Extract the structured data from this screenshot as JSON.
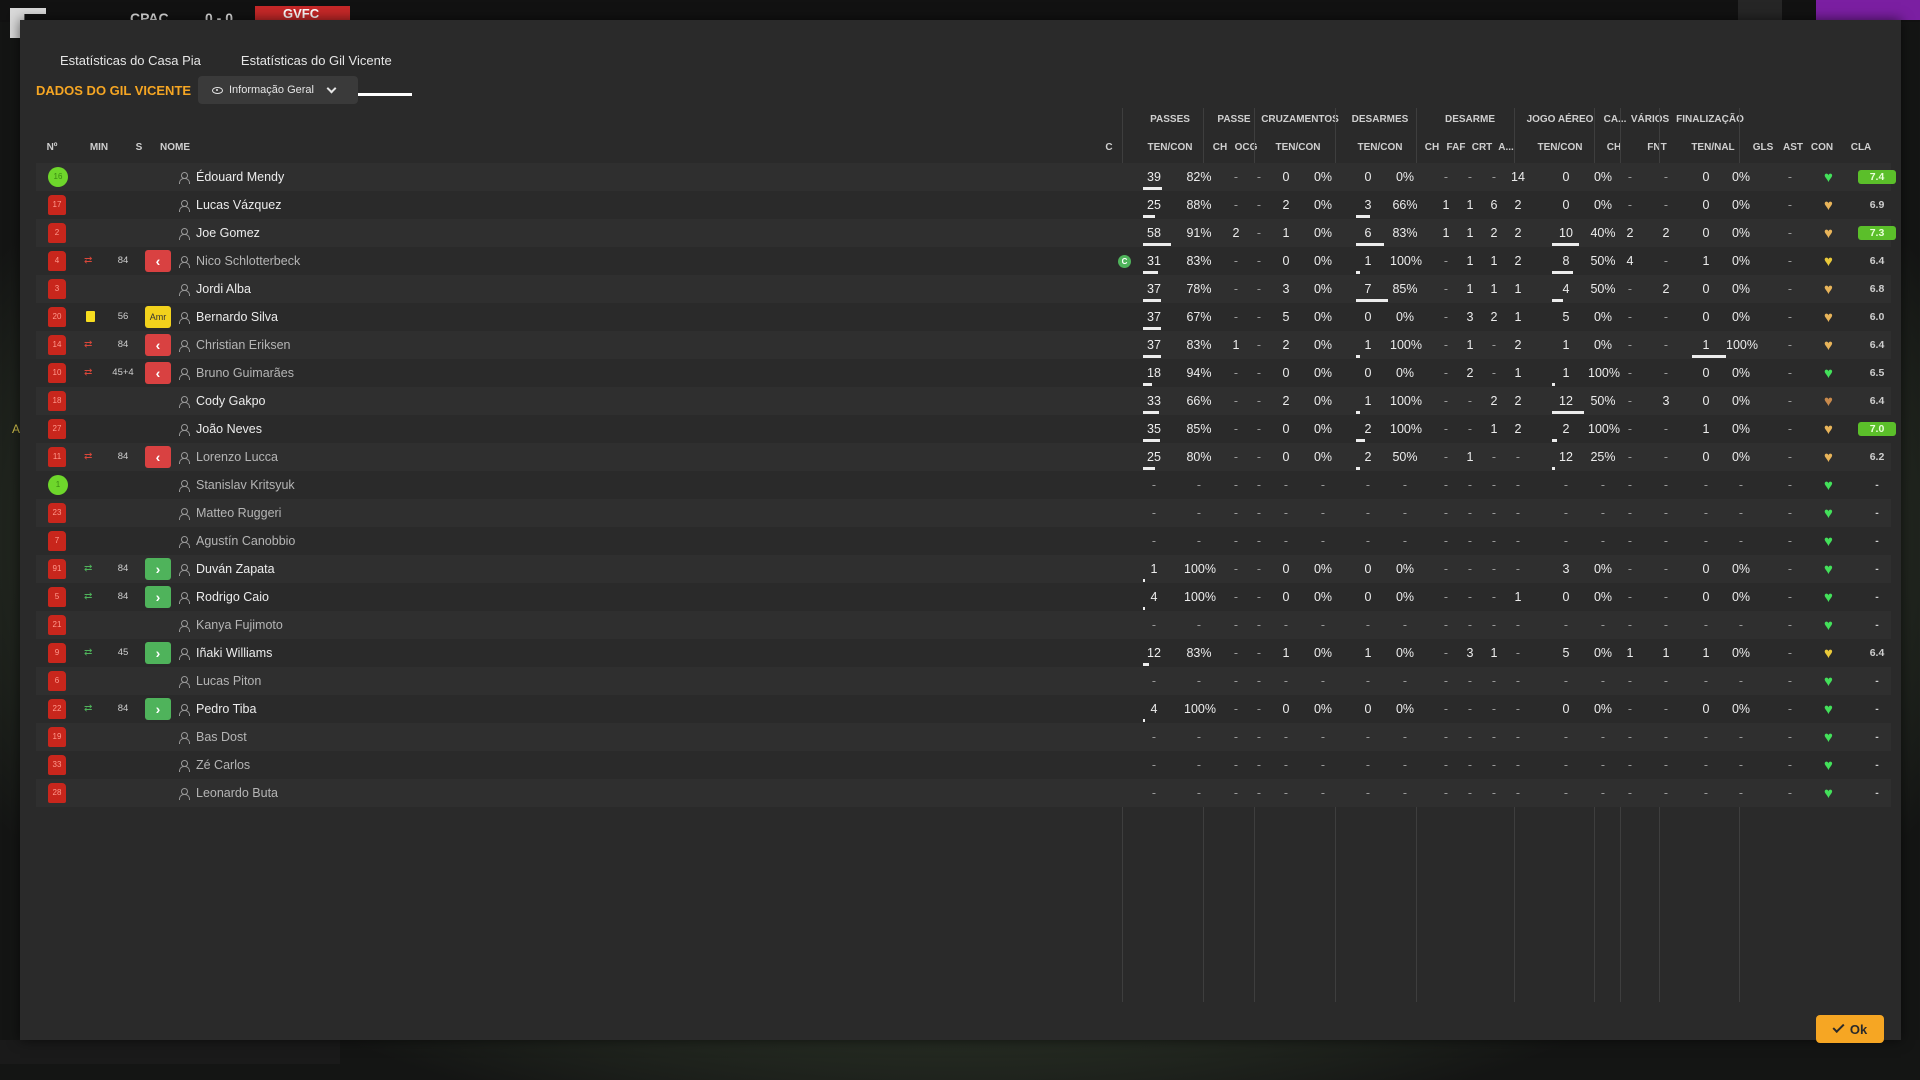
{
  "background": {
    "home_abbr": "CPAC",
    "score": "0 - 0",
    "away_abbr": "GVFC",
    "side_letter": "A"
  },
  "tabs": [
    {
      "label": "Estatísticas do Casa Pia",
      "active": false
    },
    {
      "label": "Estatísticas do Gil Vicente",
      "active": true
    }
  ],
  "section_title": "DADOS DO GIL VICENTE",
  "view_select": {
    "selected": "Informação Geral"
  },
  "group_headers": {
    "passes": "PASSES",
    "passe": "PASSE",
    "cruzamentos": "CRUZAMENTOS",
    "desarmes": "DESARMES",
    "desarme": "DESARME",
    "jogo_aereo": "JOGO AÉREO",
    "ca": "CA...",
    "varios": "VÁRIOS",
    "finalizacao": "FINALIZAÇÃO"
  },
  "col_headers": {
    "n": "Nº",
    "min": "MIN",
    "s": "S",
    "nome": "NOME",
    "c": "C",
    "passes_tc": "TEN/CON",
    "passe_ch": "CH",
    "passe_ocg": "OCG",
    "cruz_tc": "TEN/CON",
    "des_tc": "TEN/CON",
    "desarme_ch": "CH",
    "desarme_faf": "FAF",
    "desarme_crt": "CRT",
    "desarme_a": "A...",
    "aereo_tc": "TEN/CON",
    "ca_ch": "CH",
    "varios_fnt": "FNT",
    "fin_tn": "TEN/NAL",
    "gls": "GLS",
    "ast": "AST",
    "con": "CON",
    "cla": "CLA"
  },
  "players": [
    {
      "no": "16",
      "gk": true,
      "event": "",
      "min": "",
      "s": "",
      "name": "Édouard Mendy",
      "dim": false,
      "captain": false,
      "p_t": "39",
      "p_pct": "82%",
      "p_bar": 0.67,
      "ch": "-",
      "ocg": "-",
      "cr_t": "0",
      "cr_pct": "0%",
      "d_t": "0",
      "d_pct": "0%",
      "d_bar": 0,
      "dch": "-",
      "faf": "-",
      "crt": "-",
      "da": "14",
      "a_t": "0",
      "a_pct": "0%",
      "a_bar": 0,
      "cach": "-",
      "fnt": "-",
      "f_t": "0",
      "f_pct": "0%",
      "f_bar": 0,
      "gls": "",
      "ast": "-",
      "con": "g",
      "cla": "7.4",
      "cla_hl": true
    },
    {
      "no": "17",
      "gk": false,
      "event": "",
      "min": "",
      "s": "",
      "name": "Lucas Vázquez",
      "dim": false,
      "captain": false,
      "p_t": "25",
      "p_pct": "88%",
      "p_bar": 0.43,
      "ch": "-",
      "ocg": "-",
      "cr_t": "2",
      "cr_pct": "0%",
      "d_t": "3",
      "d_pct": "66%",
      "d_bar": 0.43,
      "dch": "1",
      "faf": "1",
      "crt": "6",
      "da": "2",
      "a_t": "0",
      "a_pct": "0%",
      "a_bar": 0,
      "cach": "-",
      "fnt": "-",
      "f_t": "0",
      "f_pct": "0%",
      "f_bar": 0,
      "gls": "",
      "ast": "-",
      "con": "o",
      "cla": "6.9",
      "cla_hl": false
    },
    {
      "no": "2",
      "gk": false,
      "event": "",
      "min": "",
      "s": "",
      "name": "Joe Gomez",
      "dim": false,
      "captain": false,
      "p_t": "58",
      "p_pct": "91%",
      "p_bar": 1.0,
      "ch": "2",
      "ocg": "-",
      "cr_t": "1",
      "cr_pct": "0%",
      "d_t": "6",
      "d_pct": "83%",
      "d_bar": 0.86,
      "dch": "1",
      "faf": "1",
      "crt": "2",
      "da": "2",
      "a_t": "10",
      "a_pct": "40%",
      "a_bar": 0.83,
      "cach": "2",
      "fnt": "2",
      "f_t": "0",
      "f_pct": "0%",
      "f_bar": 0,
      "gls": "",
      "ast": "-",
      "con": "o",
      "cla": "7.3",
      "cla_hl": true
    },
    {
      "no": "4",
      "gk": false,
      "event": "out",
      "min": "84",
      "s": "out",
      "name": "Nico Schlotterbeck",
      "dim": true,
      "captain": true,
      "p_t": "31",
      "p_pct": "83%",
      "p_bar": 0.53,
      "ch": "-",
      "ocg": "-",
      "cr_t": "0",
      "cr_pct": "0%",
      "d_t": "1",
      "d_pct": "100%",
      "d_bar": 0.14,
      "dch": "-",
      "faf": "1",
      "crt": "1",
      "da": "2",
      "a_t": "8",
      "a_pct": "50%",
      "a_bar": 0.67,
      "cach": "4",
      "fnt": "-",
      "f_t": "1",
      "f_pct": "0%",
      "f_bar": 0,
      "gls": "",
      "ast": "-",
      "con": "y",
      "cla": "6.4",
      "cla_hl": false
    },
    {
      "no": "3",
      "gk": false,
      "event": "",
      "min": "",
      "s": "",
      "name": "Jordi Alba",
      "dim": false,
      "captain": false,
      "p_t": "37",
      "p_pct": "78%",
      "p_bar": 0.64,
      "ch": "-",
      "ocg": "-",
      "cr_t": "3",
      "cr_pct": "0%",
      "d_t": "7",
      "d_pct": "85%",
      "d_bar": 1.0,
      "dch": "-",
      "faf": "1",
      "crt": "1",
      "da": "1",
      "a_t": "4",
      "a_pct": "50%",
      "a_bar": 0.33,
      "cach": "-",
      "fnt": "2",
      "f_t": "0",
      "f_pct": "0%",
      "f_bar": 0,
      "gls": "",
      "ast": "-",
      "con": "o",
      "cla": "6.8",
      "cla_hl": false
    },
    {
      "no": "20",
      "gk": false,
      "event": "yellow",
      "min": "56",
      "s": "amr",
      "name": "Bernardo Silva",
      "dim": false,
      "captain": false,
      "p_t": "37",
      "p_pct": "67%",
      "p_bar": 0.64,
      "ch": "-",
      "ocg": "-",
      "cr_t": "5",
      "cr_pct": "0%",
      "d_t": "0",
      "d_pct": "0%",
      "d_bar": 0,
      "dch": "-",
      "faf": "3",
      "crt": "2",
      "da": "1",
      "a_t": "5",
      "a_pct": "0%",
      "a_bar": 0,
      "cach": "-",
      "fnt": "-",
      "f_t": "0",
      "f_pct": "0%",
      "f_bar": 0,
      "gls": "",
      "ast": "-",
      "con": "o",
      "cla": "6.0",
      "cla_hl": false
    },
    {
      "no": "14",
      "gk": false,
      "event": "out",
      "min": "84",
      "s": "out",
      "name": "Christian Eriksen",
      "dim": true,
      "captain": false,
      "p_t": "37",
      "p_pct": "83%",
      "p_bar": 0.64,
      "ch": "1",
      "ocg": "-",
      "cr_t": "2",
      "cr_pct": "0%",
      "d_t": "1",
      "d_pct": "100%",
      "d_bar": 0.14,
      "dch": "-",
      "faf": "1",
      "crt": "-",
      "da": "2",
      "a_t": "1",
      "a_pct": "0%",
      "a_bar": 0,
      "cach": "-",
      "fnt": "-",
      "f_t": "1",
      "f_pct": "100%",
      "f_bar": 1.0,
      "gls": "",
      "ast": "-",
      "con": "o",
      "cla": "6.4",
      "cla_hl": false
    },
    {
      "no": "10",
      "gk": false,
      "event": "out",
      "min": "45+4",
      "s": "out",
      "name": "Bruno Guimarães",
      "dim": true,
      "captain": false,
      "p_t": "18",
      "p_pct": "94%",
      "p_bar": 0.31,
      "ch": "-",
      "ocg": "-",
      "cr_t": "0",
      "cr_pct": "0%",
      "d_t": "0",
      "d_pct": "0%",
      "d_bar": 0,
      "dch": "-",
      "faf": "2",
      "crt": "-",
      "da": "1",
      "a_t": "1",
      "a_pct": "100%",
      "a_bar": 0.08,
      "cach": "-",
      "fnt": "-",
      "f_t": "0",
      "f_pct": "0%",
      "f_bar": 0,
      "gls": "",
      "ast": "-",
      "con": "g",
      "cla": "6.5",
      "cla_hl": false
    },
    {
      "no": "18",
      "gk": false,
      "event": "",
      "min": "",
      "s": "",
      "name": "Cody Gakpo",
      "dim": false,
      "captain": false,
      "p_t": "33",
      "p_pct": "66%",
      "p_bar": 0.57,
      "ch": "-",
      "ocg": "-",
      "cr_t": "2",
      "cr_pct": "0%",
      "d_t": "1",
      "d_pct": "100%",
      "d_bar": 0.14,
      "dch": "-",
      "faf": "-",
      "crt": "2",
      "da": "2",
      "a_t": "12",
      "a_pct": "50%",
      "a_bar": 1.0,
      "cach": "-",
      "fnt": "3",
      "f_t": "0",
      "f_pct": "0%",
      "f_bar": 0,
      "gls": "",
      "ast": "-",
      "con": "b",
      "cla": "6.4",
      "cla_hl": false
    },
    {
      "no": "27",
      "gk": false,
      "event": "",
      "min": "",
      "s": "",
      "name": "João Neves",
      "dim": false,
      "captain": false,
      "p_t": "35",
      "p_pct": "85%",
      "p_bar": 0.6,
      "ch": "-",
      "ocg": "-",
      "cr_t": "0",
      "cr_pct": "0%",
      "d_t": "2",
      "d_pct": "100%",
      "d_bar": 0.29,
      "dch": "-",
      "faf": "-",
      "crt": "1",
      "da": "2",
      "a_t": "2",
      "a_pct": "100%",
      "a_bar": 0.17,
      "cach": "-",
      "fnt": "-",
      "f_t": "1",
      "f_pct": "0%",
      "f_bar": 0,
      "gls": "",
      "ast": "-",
      "con": "o",
      "cla": "7.0",
      "cla_hl": true
    },
    {
      "no": "11",
      "gk": false,
      "event": "out",
      "min": "84",
      "s": "out",
      "name": "Lorenzo Lucca",
      "dim": true,
      "captain": false,
      "p_t": "25",
      "p_pct": "80%",
      "p_bar": 0.43,
      "ch": "-",
      "ocg": "-",
      "cr_t": "0",
      "cr_pct": "0%",
      "d_t": "2",
      "d_pct": "50%",
      "d_bar": 0.14,
      "dch": "-",
      "faf": "1",
      "crt": "-",
      "da": "-",
      "a_t": "12",
      "a_pct": "25%",
      "a_bar": 0.08,
      "cach": "-",
      "fnt": "-",
      "f_t": "0",
      "f_pct": "0%",
      "f_bar": 0,
      "gls": "",
      "ast": "-",
      "con": "o",
      "cla": "6.2",
      "cla_hl": false
    },
    {
      "no": "1",
      "gk": true,
      "event": "",
      "min": "",
      "s": "",
      "name": "Stanislav Kritsyuk",
      "dim": true,
      "captain": false,
      "empty": true,
      "con": "g",
      "cla": "-",
      "cla_hl": false
    },
    {
      "no": "23",
      "gk": false,
      "event": "",
      "min": "",
      "s": "",
      "name": "Matteo Ruggeri",
      "dim": true,
      "captain": false,
      "empty": true,
      "con": "g",
      "cla": "-",
      "cla_hl": false
    },
    {
      "no": "7",
      "gk": false,
      "event": "",
      "min": "",
      "s": "",
      "name": "Agustín Canobbio",
      "dim": true,
      "captain": false,
      "empty": true,
      "con": "g",
      "cla": "-",
      "cla_hl": false
    },
    {
      "no": "91",
      "gk": false,
      "event": "in",
      "min": "84",
      "s": "in",
      "name": "Duván Zapata",
      "dim": false,
      "captain": false,
      "p_t": "1",
      "p_pct": "100%",
      "p_bar": 0.02,
      "ch": "-",
      "ocg": "-",
      "cr_t": "0",
      "cr_pct": "0%",
      "d_t": "0",
      "d_pct": "0%",
      "d_bar": 0,
      "dch": "-",
      "faf": "-",
      "crt": "-",
      "da": "-",
      "a_t": "3",
      "a_pct": "0%",
      "a_bar": 0,
      "cach": "-",
      "fnt": "-",
      "f_t": "0",
      "f_pct": "0%",
      "f_bar": 0,
      "gls": "",
      "ast": "-",
      "con": "g",
      "cla": "-",
      "cla_hl": false
    },
    {
      "no": "5",
      "gk": false,
      "event": "in",
      "min": "84",
      "s": "in",
      "name": "Rodrigo Caio",
      "dim": false,
      "captain": false,
      "p_t": "4",
      "p_pct": "100%",
      "p_bar": 0.07,
      "ch": "-",
      "ocg": "-",
      "cr_t": "0",
      "cr_pct": "0%",
      "d_t": "0",
      "d_pct": "0%",
      "d_bar": 0,
      "dch": "-",
      "faf": "-",
      "crt": "-",
      "da": "1",
      "a_t": "0",
      "a_pct": "0%",
      "a_bar": 0,
      "cach": "-",
      "fnt": "-",
      "f_t": "0",
      "f_pct": "0%",
      "f_bar": 0,
      "gls": "",
      "ast": "-",
      "con": "g",
      "cla": "-",
      "cla_hl": false
    },
    {
      "no": "21",
      "gk": false,
      "event": "",
      "min": "",
      "s": "",
      "name": "Kanya Fujimoto",
      "dim": true,
      "captain": false,
      "empty": true,
      "con": "g",
      "cla": "-",
      "cla_hl": false
    },
    {
      "no": "9",
      "gk": false,
      "event": "in",
      "min": "45",
      "s": "in",
      "name": "Iñaki Williams",
      "dim": false,
      "captain": false,
      "p_t": "12",
      "p_pct": "83%",
      "p_bar": 0.21,
      "ch": "-",
      "ocg": "-",
      "cr_t": "1",
      "cr_pct": "0%",
      "d_t": "1",
      "d_pct": "0%",
      "d_bar": 0,
      "dch": "-",
      "faf": "3",
      "crt": "1",
      "da": "-",
      "a_t": "5",
      "a_pct": "0%",
      "a_bar": 0,
      "cach": "1",
      "fnt": "1",
      "f_t": "1",
      "f_pct": "0%",
      "f_bar": 0,
      "gls": "",
      "ast": "-",
      "con": "y",
      "cla": "6.4",
      "cla_hl": false
    },
    {
      "no": "6",
      "gk": false,
      "event": "",
      "min": "",
      "s": "",
      "name": "Lucas Piton",
      "dim": true,
      "captain": false,
      "empty": true,
      "con": "g",
      "cla": "-",
      "cla_hl": false
    },
    {
      "no": "22",
      "gk": false,
      "event": "in",
      "min": "84",
      "s": "in",
      "name": "Pedro Tiba",
      "dim": false,
      "captain": false,
      "p_t": "4",
      "p_pct": "100%",
      "p_bar": 0.07,
      "ch": "-",
      "ocg": "-",
      "cr_t": "0",
      "cr_pct": "0%",
      "d_t": "0",
      "d_pct": "0%",
      "d_bar": 0,
      "dch": "-",
      "faf": "-",
      "crt": "-",
      "da": "-",
      "a_t": "0",
      "a_pct": "0%",
      "a_bar": 0,
      "cach": "-",
      "fnt": "-",
      "f_t": "0",
      "f_pct": "0%",
      "f_bar": 0,
      "gls": "",
      "ast": "-",
      "con": "g",
      "cla": "-",
      "cla_hl": false
    },
    {
      "no": "19",
      "gk": false,
      "event": "",
      "min": "",
      "s": "",
      "name": "Bas Dost",
      "dim": true,
      "captain": false,
      "empty": true,
      "con": "g",
      "cla": "-",
      "cla_hl": false
    },
    {
      "no": "33",
      "gk": false,
      "event": "",
      "min": "",
      "s": "",
      "name": "Zé Carlos",
      "dim": true,
      "captain": false,
      "empty": true,
      "con": "g",
      "cla": "-",
      "cla_hl": false
    },
    {
      "no": "28",
      "gk": false,
      "event": "",
      "min": "",
      "s": "",
      "name": "Leonardo Buta",
      "dim": true,
      "captain": false,
      "empty": true,
      "con": "g",
      "cla": "-",
      "cla_hl": false
    }
  ],
  "ok_button": {
    "label": "Ok"
  },
  "colors": {
    "accent": "#f6a623",
    "sub_out": "#d94141",
    "sub_in": "#4fb35b",
    "rating_hl": "#5bbf2a"
  }
}
